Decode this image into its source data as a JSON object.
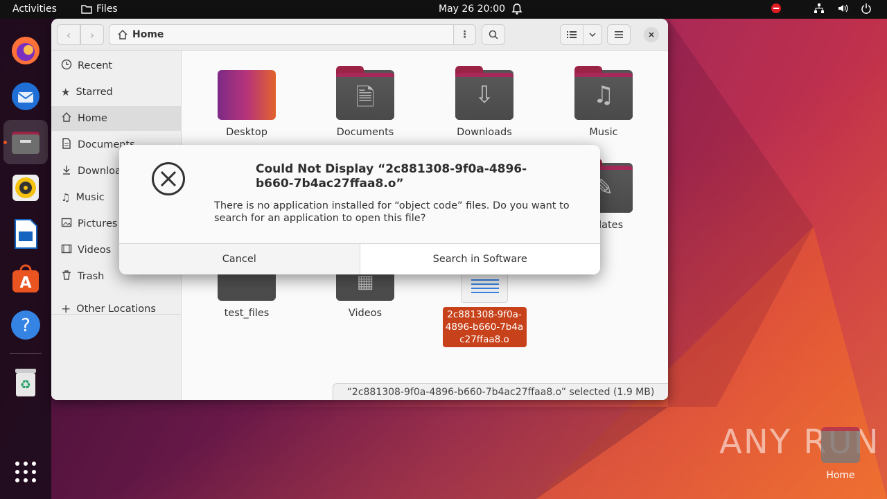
{
  "topbar": {
    "activities": "Activities",
    "app_name": "Files",
    "clock": "May 26  20:00"
  },
  "dock": {
    "items": [
      "firefox-icon",
      "thunderbird-icon",
      "files-icon",
      "rhythmbox-icon",
      "writer-icon",
      "software-icon",
      "help-icon",
      "trash-icon",
      "app-grid-icon"
    ]
  },
  "window": {
    "path": "Home",
    "sidebar": {
      "items": [
        {
          "label": "Recent",
          "icon": "clock-icon"
        },
        {
          "label": "Starred",
          "icon": "star-icon"
        },
        {
          "label": "Home",
          "icon": "home-icon"
        },
        {
          "label": "Documents",
          "icon": "document-icon"
        },
        {
          "label": "Downloads",
          "icon": "download-icon"
        },
        {
          "label": "Music",
          "icon": "music-icon"
        },
        {
          "label": "Pictures",
          "icon": "picture-icon"
        },
        {
          "label": "Videos",
          "icon": "video-icon"
        },
        {
          "label": "Trash",
          "icon": "trash-icon"
        }
      ],
      "other_locations": "Other Locations"
    },
    "files": [
      {
        "name": "Desktop"
      },
      {
        "name": "Documents"
      },
      {
        "name": "Downloads"
      },
      {
        "name": "Music"
      },
      {
        "name": "plates"
      },
      {
        "name": "test_files"
      },
      {
        "name": "Videos"
      },
      {
        "name": "2c881308-9f0a-4896-b660-7b4ac27ffaa8.o"
      }
    ],
    "status": "“2c881308-9f0a-4896-b660-7b4ac27ffaa8.o” selected  (1.9 MB)"
  },
  "dialog": {
    "title": "Could Not Display “2c881308-9f0a-4896-b660-7b4ac27ffaa8.o”",
    "message": "There is no application installed for “object code” files. Do you want to search for an application to open this file?",
    "cancel_label": "Cancel",
    "search_label": "Search in Software"
  },
  "desktop": {
    "home_label": "Home",
    "watermark": "ANY RUN"
  },
  "colors": {
    "accent": "#e95420",
    "selection": "#c7421a",
    "folder_tab": "#a8285a"
  }
}
